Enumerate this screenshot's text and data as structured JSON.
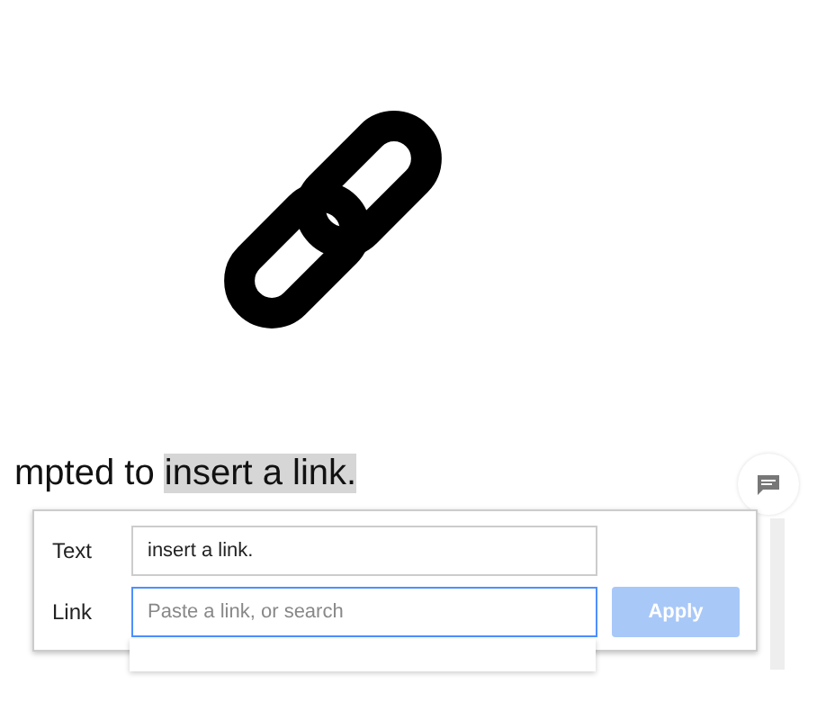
{
  "sentence": {
    "before": "mpted to ",
    "selected": "insert a link."
  },
  "link_dialog": {
    "text_label": "Text",
    "text_value": "insert a link.",
    "link_label": "Link",
    "link_placeholder": "Paste a link, or search",
    "link_focused": true,
    "apply_button": {
      "label": "Apply",
      "disabled": true
    }
  }
}
